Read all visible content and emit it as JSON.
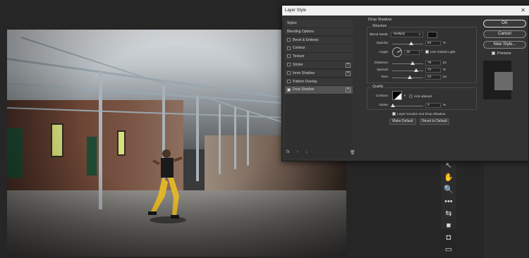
{
  "dialog": {
    "title": "Layer Style",
    "close_label": "✕",
    "style_list": [
      {
        "label": "Styles",
        "checkbox": false,
        "checked": false,
        "plus": false,
        "active": false
      },
      {
        "label": "Blending Options",
        "checkbox": false,
        "checked": false,
        "plus": false,
        "active": false
      },
      {
        "label": "Bevel & Emboss",
        "checkbox": true,
        "checked": false,
        "plus": false,
        "active": false
      },
      {
        "label": "Contour",
        "checkbox": true,
        "checked": false,
        "plus": false,
        "active": false
      },
      {
        "label": "Texture",
        "checkbox": true,
        "checked": false,
        "plus": false,
        "active": false
      },
      {
        "label": "Stroke",
        "checkbox": true,
        "checked": false,
        "plus": true,
        "active": false
      },
      {
        "label": "Inner Shadow",
        "checkbox": true,
        "checked": false,
        "plus": true,
        "active": false
      },
      {
        "label": "Pattern Overlay",
        "checkbox": true,
        "checked": false,
        "plus": false,
        "active": false
      },
      {
        "label": "Drop Shadow",
        "checkbox": true,
        "checked": true,
        "plus": true,
        "active": true
      }
    ],
    "list_footer": {
      "fx": "fx",
      "up": "↑",
      "down": "↓",
      "trash": "🗑"
    },
    "panel": {
      "heading": "Drop Shadow",
      "structure_label": "Structure",
      "blend_mode_label": "Blend Mode:",
      "blend_mode_value": "Multiply",
      "shadow_color": "#121212",
      "opacity_label": "Opacity:",
      "opacity_value": "63",
      "opacity_unit": "%",
      "angle_label": "Angle:",
      "angle_value": "30",
      "angle_unit": "°",
      "global_light_label": "Use Global Light",
      "distance_label": "Distance:",
      "distance_value": "79",
      "distance_unit": "px",
      "spread_label": "Spread:",
      "spread_value": "74",
      "spread_unit": "%",
      "size_label": "Size:",
      "size_value": "24",
      "size_unit": "px",
      "quality_label": "Quality",
      "contour_label": "Contour:",
      "antialiased_label": "Anti-aliased",
      "noise_label": "Noise:",
      "noise_value": "0",
      "noise_unit": "%",
      "knockout_label": "Layer Knocks Out Drop Shadow",
      "make_default_label": "Make Default",
      "reset_default_label": "Reset to Default"
    },
    "buttons": {
      "ok": "OK",
      "cancel": "Cancel",
      "new_style": "New Style...",
      "preview": "Preview"
    }
  },
  "tools": [
    {
      "icon": "pointer-icon",
      "glyph": "↖"
    },
    {
      "icon": "hand-icon",
      "glyph": "✋"
    },
    {
      "icon": "zoom-icon",
      "glyph": "🔍"
    },
    {
      "icon": "more-tools-icon",
      "glyph": "•••"
    },
    {
      "icon": "swap-colors-icon",
      "glyph": "⇆"
    },
    {
      "icon": "color-swatch-icon",
      "glyph": "■"
    },
    {
      "icon": "quick-mask-icon",
      "glyph": "◘"
    },
    {
      "icon": "screen-mode-icon",
      "glyph": "▭"
    }
  ],
  "colors": {
    "dialog_bg": "#323232",
    "titlebar_bg": "#f0f0f0",
    "app_bg": "#262626"
  }
}
